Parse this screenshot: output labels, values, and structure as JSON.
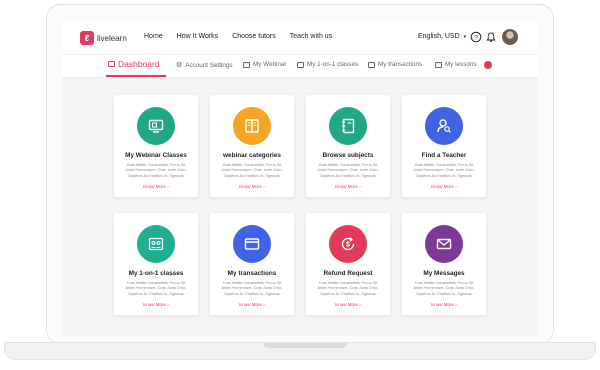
{
  "header": {
    "logo_text": "livelearn",
    "nav": [
      "Home",
      "How It Works",
      "Choose tutors",
      "Teach with us"
    ],
    "language_currency": "English, USD"
  },
  "tabs": [
    {
      "label": "Dashboard",
      "icon": "dashboard-icon",
      "active": true
    },
    {
      "label": "Account Settings",
      "icon": "settings-icon"
    },
    {
      "label": "My Webinar",
      "icon": "monitor-icon"
    },
    {
      "label": "My 1-on-1 classes",
      "icon": "classes-icon"
    },
    {
      "label": "My transactions",
      "icon": "card-icon"
    },
    {
      "label": "My lessons",
      "icon": "book-icon"
    }
  ],
  "cards": [
    {
      "title": "My Webinar Classes",
      "icon": "monitor-icon",
      "color": "#20a787",
      "desc": "Cras Mattis Consectetur Purus Sit Amet Fermentum. Cras Justo Odio, Dapibus Ac Facilisis In, Egestas",
      "link": "Know More"
    },
    {
      "title": "webinar categories",
      "icon": "book-icon",
      "color": "#f5a623",
      "desc": "Cras Mattis Consectetur Purus Sit Amet Fermentum. Cras Justo Odio, Dapibus Ac Facilisis In, Egestas",
      "link": "Know More"
    },
    {
      "title": "Browse subjects",
      "icon": "notebook-icon",
      "color": "#20a787",
      "desc": "Cras Mattis Consectetur Purus Sit Amet Fermentum. Cras Justo Odio, Dapibus Ac Facilisis In, Egestas",
      "link": "Know More"
    },
    {
      "title": "Find a Teacher",
      "icon": "user-search-icon",
      "color": "#3e63e3",
      "desc": "Cras Mattis Consectetur Purus Sit Amet Fermentum. Cras Justo Odio, Dapibus Ac Facilisis In, Egestas",
      "link": "Know More"
    },
    {
      "title": "My 1-on-1 classes",
      "icon": "contacts-icon",
      "color": "#1fae8f",
      "desc": "Cras Mattis Consectetur Purus Sit Amet Fermentum. Cras Justo Odio, Dapibus Ac Facilisis In, Egestas",
      "link": "Know More"
    },
    {
      "title": "My transactions",
      "icon": "card-icon",
      "color": "#3e63e3",
      "desc": "Cras Mattis Consectetur Purus Sit Amet Fermentum. Cras Justo Odio, Dapibus Ac Facilisis In, Egestas",
      "link": "Know More"
    },
    {
      "title": "Refund Request",
      "icon": "refund-icon",
      "color": "#e23a5b",
      "desc": "Cras Mattis Consectetur Purus Sit Amet Fermentum. Cras Justo Odio, Dapibus Ac Facilisis In, Egestas",
      "link": "Know More"
    },
    {
      "title": "My Messages",
      "icon": "mail-icon",
      "color": "#7b3a96",
      "desc": "Cras Mattis Consectetur Purus Sit Amet Fermentum. Cras Justo Odio, Dapibus Ac Facilisis In, Egestas",
      "link": "Know More"
    }
  ]
}
